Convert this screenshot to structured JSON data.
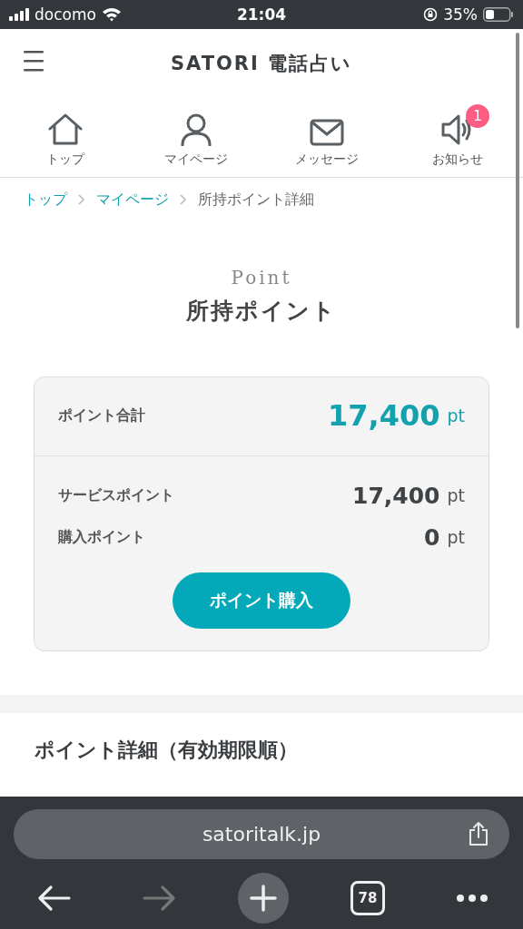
{
  "status_bar": {
    "carrier": "docomo",
    "time": "21:04",
    "battery": "35%"
  },
  "header": {
    "logo": "SATORI 電話占い"
  },
  "nav": [
    {
      "kind": "home",
      "label": "トップ"
    },
    {
      "kind": "person",
      "label": "マイページ"
    },
    {
      "kind": "mail",
      "label": "メッセージ"
    },
    {
      "kind": "speaker",
      "label": "お知らせ",
      "badge": "1"
    }
  ],
  "breadcrumb": [
    {
      "label": "トップ",
      "link": true
    },
    {
      "label": "マイページ",
      "link": true
    },
    {
      "label": "所持ポイント詳細",
      "link": false
    }
  ],
  "page_title": {
    "eyebrow": "Point",
    "title": "所持ポイント"
  },
  "points_card": {
    "total": {
      "label": "ポイント合計",
      "value": "17,400",
      "unit": "pt"
    },
    "rows": [
      {
        "label": "サービスポイント",
        "value": "17,400",
        "unit": "pt"
      },
      {
        "label": "購入ポイント",
        "value": "0",
        "unit": "pt"
      }
    ],
    "button": "ポイント購入"
  },
  "section_heading": "ポイント詳細（有効期限順）",
  "browser": {
    "url": "satoritalk.jp",
    "toolbar": [
      {
        "kind": "back",
        "disabled": false
      },
      {
        "kind": "forward",
        "disabled": true
      },
      {
        "kind": "new_tab",
        "disabled": false
      },
      {
        "kind": "tabs",
        "label": "78",
        "disabled": false
      },
      {
        "kind": "more",
        "disabled": false
      }
    ]
  }
}
